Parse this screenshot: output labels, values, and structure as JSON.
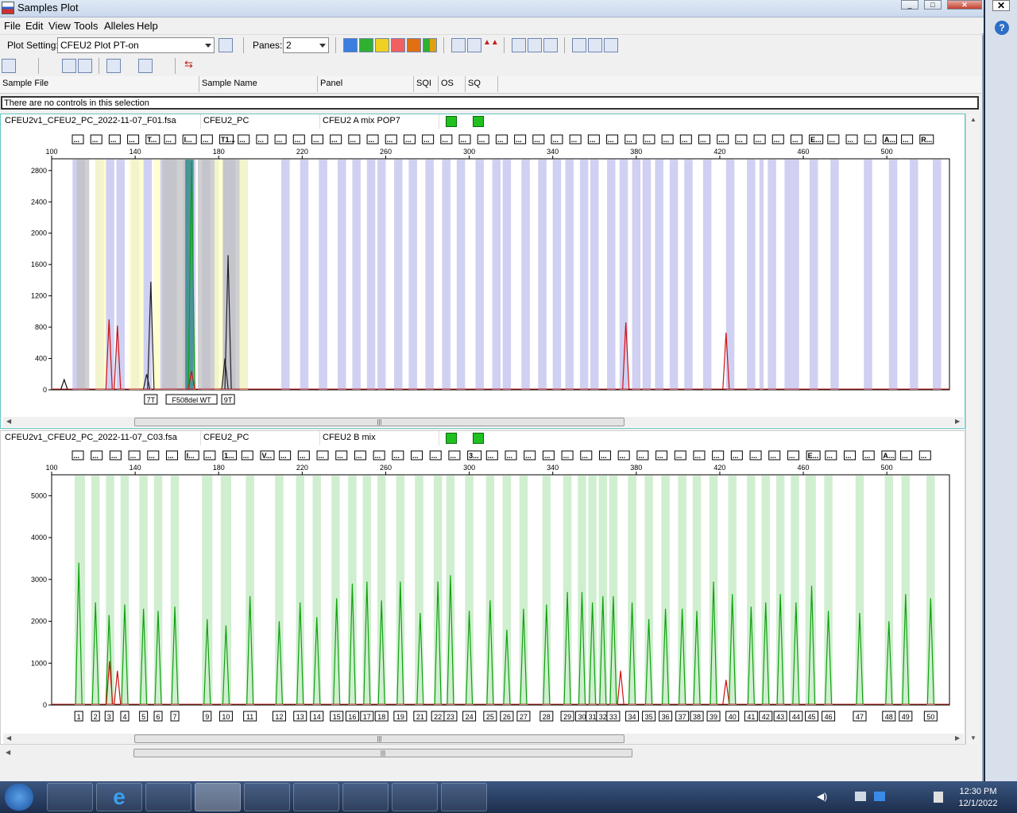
{
  "window": {
    "title": "Samples Plot"
  },
  "menu": [
    "File",
    "Edit",
    "View",
    "Tools",
    "Alleles",
    "Help"
  ],
  "toolbar": {
    "plot_setting_label": "Plot Setting:",
    "plot_setting_value": "CFEU2 Plot PT-on",
    "panes_label": "Panes:",
    "panes_value": "2"
  },
  "grid": {
    "headers": [
      "Sample File",
      "Sample Name",
      "Panel",
      "SQI",
      "OS",
      "SQ"
    ],
    "message": "There are no controls in this selection"
  },
  "panes": [
    {
      "sample_file": "CFEU2v1_CFEU2_PC_2022-11-07_F01.fsa",
      "sample_name": "CFEU2_PC",
      "panel": "CFEU2 A mix POP7",
      "bin_color": "#c8c8f0",
      "bin_labels": [
        "...",
        "...",
        "...",
        "...",
        "T...",
        "...",
        "I...",
        "...",
        "T1...",
        "...",
        "...",
        "...",
        "...",
        "...",
        "...",
        "...",
        "...",
        "...",
        "...",
        "...",
        "...",
        "...",
        "...",
        "...",
        "...",
        "...",
        "...",
        "...",
        "...",
        "...",
        "...",
        "...",
        "...",
        "...",
        "...",
        "...",
        "...",
        "...",
        "...",
        "...",
        "E...",
        "...",
        "...",
        "...",
        "A...",
        "...",
        "R..."
      ],
      "allele_labels": [
        "7T",
        "F508del WT",
        "9T"
      ],
      "x_ticks": [
        100,
        140,
        180,
        220,
        260,
        300,
        340,
        380,
        420,
        460,
        500
      ],
      "y_ticks": [
        0,
        400,
        800,
        1200,
        1600,
        2000,
        2400,
        2800
      ],
      "ylim": [
        0,
        2950
      ],
      "peaks": [
        {
          "x": 106,
          "h": 130,
          "color": "#101010"
        },
        {
          "x": 127.5,
          "h": 900,
          "color": "#d01010"
        },
        {
          "x": 131.5,
          "h": 820,
          "color": "#d01010"
        },
        {
          "x": 147.5,
          "h": 1380,
          "color": "#202020"
        },
        {
          "x": 145.5,
          "h": 200,
          "color": "#202020"
        },
        {
          "x": 167,
          "h": 2920,
          "color": "#10a010"
        },
        {
          "x": 167,
          "h": 240,
          "color": "#d01010"
        },
        {
          "x": 184.5,
          "h": 1720,
          "color": "#202020"
        },
        {
          "x": 183,
          "h": 400,
          "color": "#202020"
        },
        {
          "x": 375,
          "h": 860,
          "color": "#d01010"
        },
        {
          "x": 423,
          "h": 730,
          "color": "#d01010"
        }
      ]
    },
    {
      "sample_file": "CFEU2v1_CFEU2_PC_2022-11-07_C03.fsa",
      "sample_name": "CFEU2_PC",
      "panel": "CFEU2 B mix",
      "bin_color": "#c8ecc8",
      "bin_labels": [
        "...",
        "...",
        "...",
        "...",
        "...",
        "...",
        "I...",
        "...",
        "1...",
        "...",
        "V...",
        "...",
        "...",
        "...",
        "...",
        "...",
        "...",
        "...",
        "...",
        "...",
        "...",
        "3...",
        "...",
        "...",
        "...",
        "...",
        "...",
        "...",
        "...",
        "...",
        "...",
        "...",
        "...",
        "...",
        "...",
        "...",
        "...",
        "...",
        "...",
        "E...",
        "...",
        "...",
        "...",
        "A...",
        "...",
        "..."
      ],
      "allele_labels": [
        "1",
        "2",
        "3",
        "4",
        "5",
        "6",
        "7",
        "9",
        "10",
        "11",
        "12",
        "13",
        "14",
        "15",
        "16",
        "17",
        "18",
        "19",
        "21",
        "22",
        "23",
        "24",
        "25",
        "26",
        "27",
        "28",
        "29",
        "30",
        "31",
        "32",
        "33",
        "34",
        "35",
        "36",
        "37",
        "38",
        "39",
        "40",
        "41",
        "42",
        "43",
        "44",
        "45",
        "46",
        "47",
        "48",
        "49",
        "50"
      ],
      "x_ticks": [
        100,
        140,
        180,
        220,
        260,
        300,
        340,
        380,
        420,
        460,
        500
      ],
      "y_ticks": [
        0,
        1000,
        2000,
        3000,
        4000,
        5000
      ],
      "ylim": [
        0,
        5500
      ],
      "peaks": [
        {
          "x": 113,
          "h": 3400,
          "color": "#10a010"
        },
        {
          "x": 121,
          "h": 2450,
          "color": "#10a010"
        },
        {
          "x": 127.5,
          "h": 2150,
          "color": "#10a010"
        },
        {
          "x": 127.7,
          "h": 1050,
          "color": "#d01010"
        },
        {
          "x": 131.5,
          "h": 820,
          "color": "#d01010"
        },
        {
          "x": 135,
          "h": 2400,
          "color": "#10a010"
        },
        {
          "x": 144,
          "h": 2300,
          "color": "#10a010"
        },
        {
          "x": 151,
          "h": 2250,
          "color": "#10a010"
        },
        {
          "x": 159,
          "h": 2350,
          "color": "#10a010"
        },
        {
          "x": 174.5,
          "h": 2050,
          "color": "#10a010"
        },
        {
          "x": 183.5,
          "h": 1900,
          "color": "#10a010"
        },
        {
          "x": 195,
          "h": 2600,
          "color": "#10a010"
        },
        {
          "x": 209,
          "h": 2000,
          "color": "#10a010"
        },
        {
          "x": 219,
          "h": 2450,
          "color": "#10a010"
        },
        {
          "x": 227,
          "h": 2100,
          "color": "#10a010"
        },
        {
          "x": 236.5,
          "h": 2550,
          "color": "#10a010"
        },
        {
          "x": 244,
          "h": 2900,
          "color": "#10a010"
        },
        {
          "x": 251,
          "h": 2950,
          "color": "#10a010"
        },
        {
          "x": 258,
          "h": 2500,
          "color": "#10a010"
        },
        {
          "x": 267,
          "h": 2950,
          "color": "#10a010"
        },
        {
          "x": 276.5,
          "h": 2200,
          "color": "#10a010"
        },
        {
          "x": 285,
          "h": 2950,
          "color": "#10a010"
        },
        {
          "x": 291,
          "h": 3100,
          "color": "#10a010"
        },
        {
          "x": 300,
          "h": 2250,
          "color": "#10a010"
        },
        {
          "x": 310,
          "h": 2500,
          "color": "#10a010"
        },
        {
          "x": 318,
          "h": 1800,
          "color": "#10a010"
        },
        {
          "x": 326,
          "h": 2300,
          "color": "#10a010"
        },
        {
          "x": 337,
          "h": 2400,
          "color": "#10a010"
        },
        {
          "x": 347,
          "h": 2700,
          "color": "#10a010"
        },
        {
          "x": 354,
          "h": 2700,
          "color": "#10a010"
        },
        {
          "x": 359,
          "h": 2450,
          "color": "#10a010"
        },
        {
          "x": 364,
          "h": 2600,
          "color": "#10a010"
        },
        {
          "x": 369,
          "h": 2600,
          "color": "#10a010"
        },
        {
          "x": 372.5,
          "h": 820,
          "color": "#d01010"
        },
        {
          "x": 378,
          "h": 2450,
          "color": "#10a010"
        },
        {
          "x": 386,
          "h": 2050,
          "color": "#10a010"
        },
        {
          "x": 394,
          "h": 2300,
          "color": "#10a010"
        },
        {
          "x": 402,
          "h": 2300,
          "color": "#10a010"
        },
        {
          "x": 409,
          "h": 2250,
          "color": "#10a010"
        },
        {
          "x": 417,
          "h": 2950,
          "color": "#10a010"
        },
        {
          "x": 423,
          "h": 600,
          "color": "#d01010"
        },
        {
          "x": 426,
          "h": 2650,
          "color": "#10a010"
        },
        {
          "x": 435,
          "h": 2350,
          "color": "#10a010"
        },
        {
          "x": 442,
          "h": 2450,
          "color": "#10a010"
        },
        {
          "x": 449,
          "h": 2650,
          "color": "#10a010"
        },
        {
          "x": 456.5,
          "h": 2450,
          "color": "#10a010"
        },
        {
          "x": 464,
          "h": 2850,
          "color": "#10a010"
        },
        {
          "x": 472,
          "h": 2250,
          "color": "#10a010"
        },
        {
          "x": 487,
          "h": 2200,
          "color": "#10a010"
        },
        {
          "x": 501,
          "h": 2000,
          "color": "#10a010"
        },
        {
          "x": 509,
          "h": 2650,
          "color": "#10a010"
        },
        {
          "x": 521,
          "h": 2550,
          "color": "#10a010"
        }
      ]
    }
  ],
  "taskbar": {
    "time": "12:30 PM",
    "date": "12/1/2022"
  }
}
